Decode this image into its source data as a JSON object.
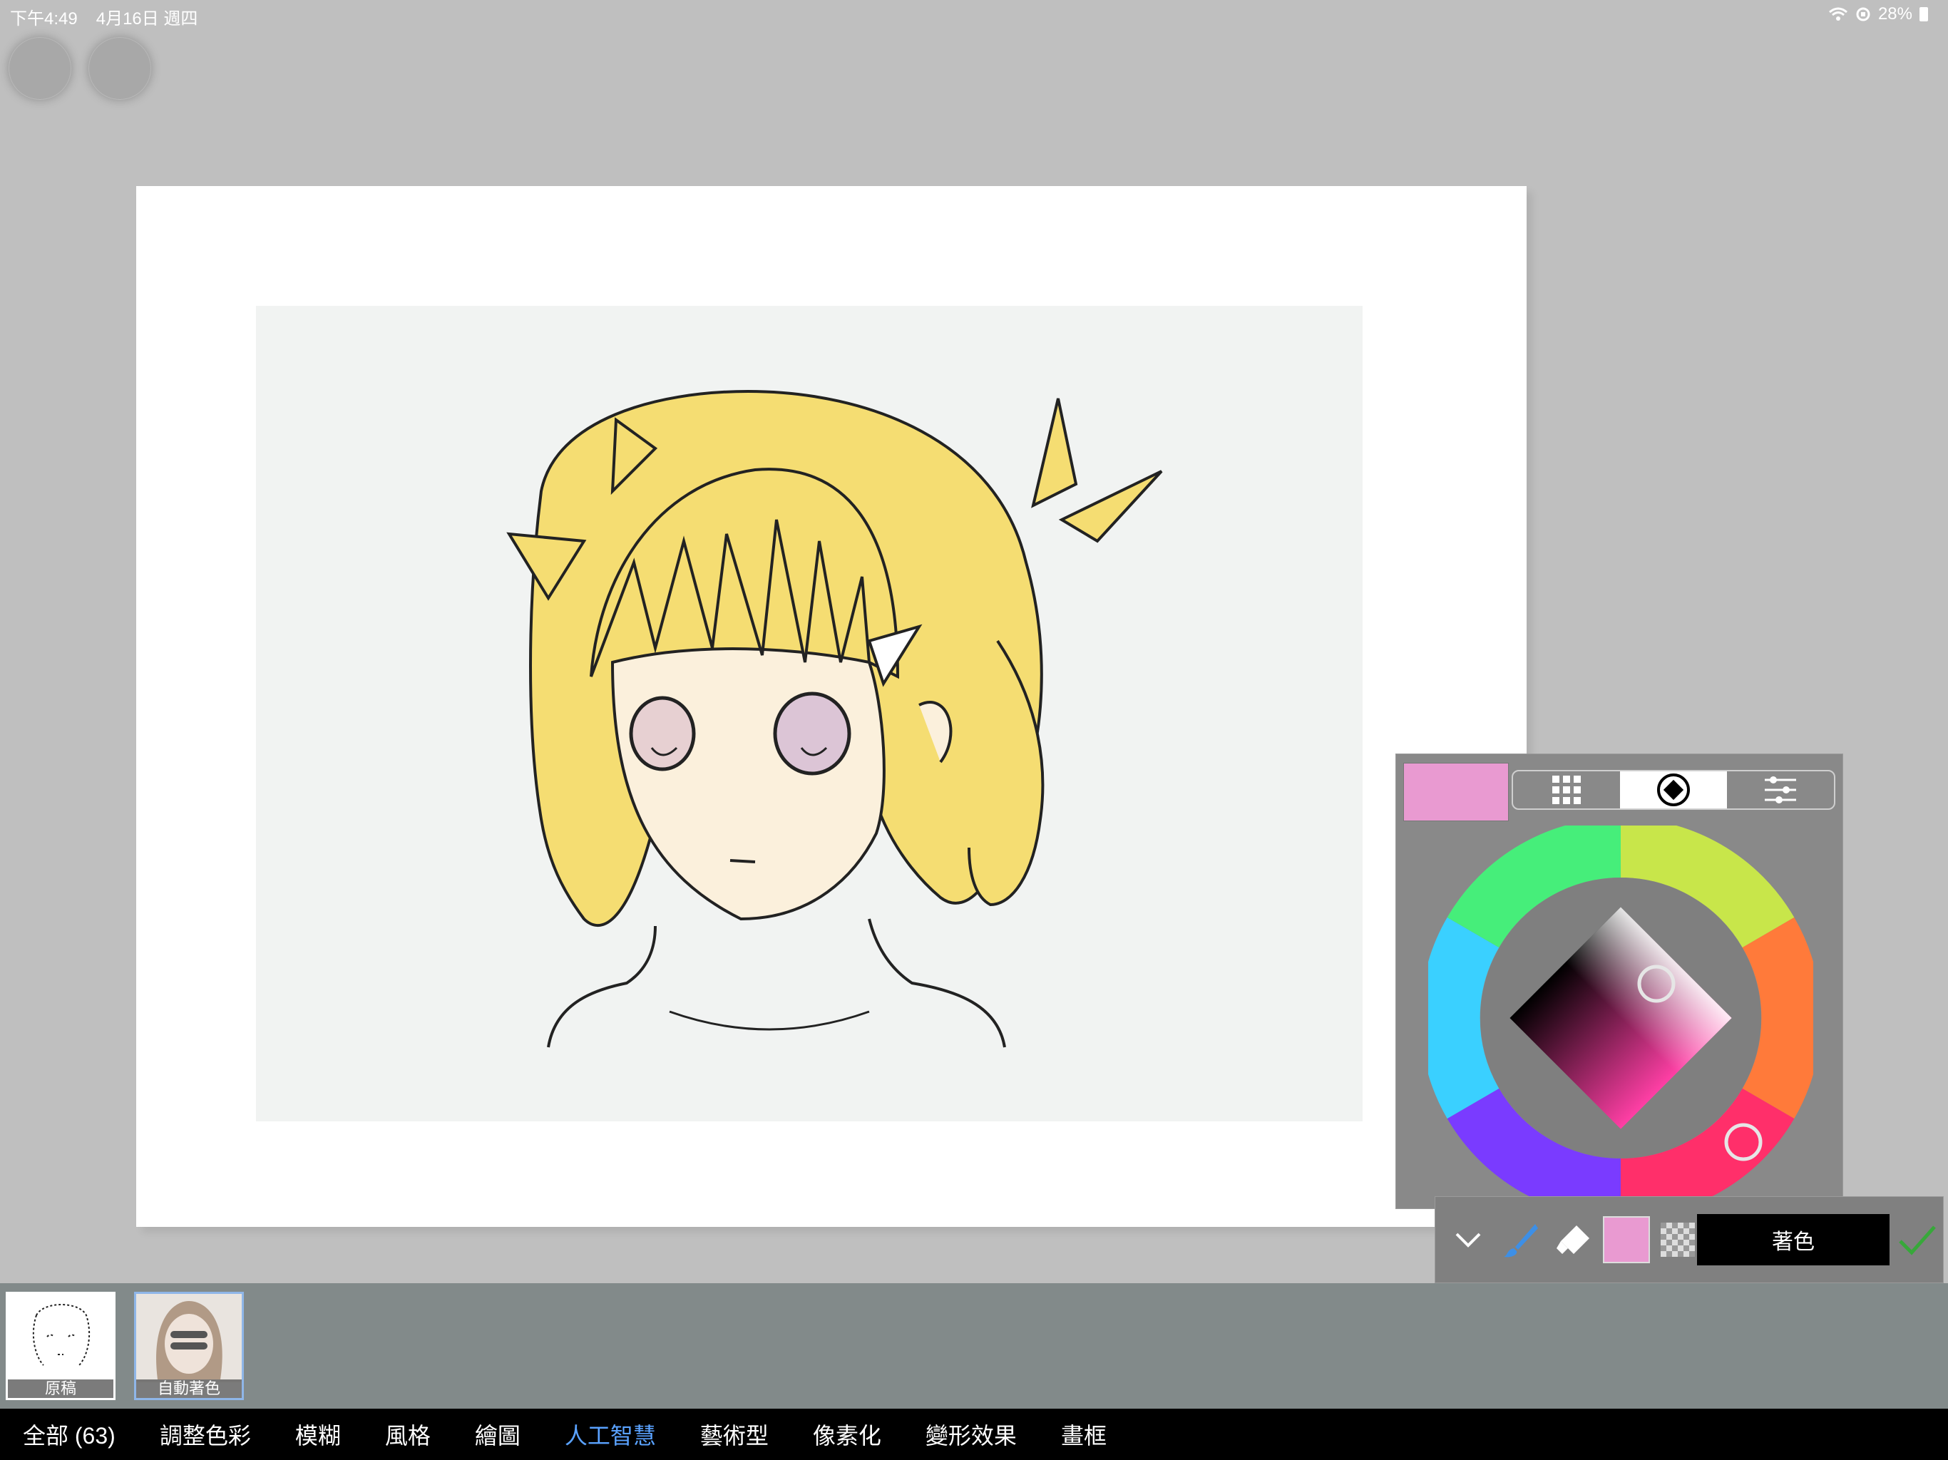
{
  "status": {
    "time": "下午4:49",
    "date": "4月16日 週四",
    "battery": "28%"
  },
  "color_panel": {
    "current_color": "#e99ad1",
    "modes": [
      "grid-icon",
      "wheel-icon",
      "sliders-icon"
    ],
    "active_mode": "wheel-icon"
  },
  "tool_row": {
    "apply_label": "著色",
    "swatch_color": "#e99ad1"
  },
  "filmstrip": {
    "items": [
      {
        "label": "原稿"
      },
      {
        "label": "自動著色"
      }
    ]
  },
  "categories": [
    {
      "label": "全部 (63)"
    },
    {
      "label": "調整色彩"
    },
    {
      "label": "模糊"
    },
    {
      "label": "風格"
    },
    {
      "label": "繪圖"
    },
    {
      "label": "人工智慧"
    },
    {
      "label": "藝術型"
    },
    {
      "label": "像素化"
    },
    {
      "label": "變形效果"
    },
    {
      "label": "畫框"
    }
  ],
  "active_category": "人工智慧",
  "colors": {
    "accent": "#5aa2ff",
    "confirm": "#37a83a",
    "hair": "#f4dc6a"
  }
}
